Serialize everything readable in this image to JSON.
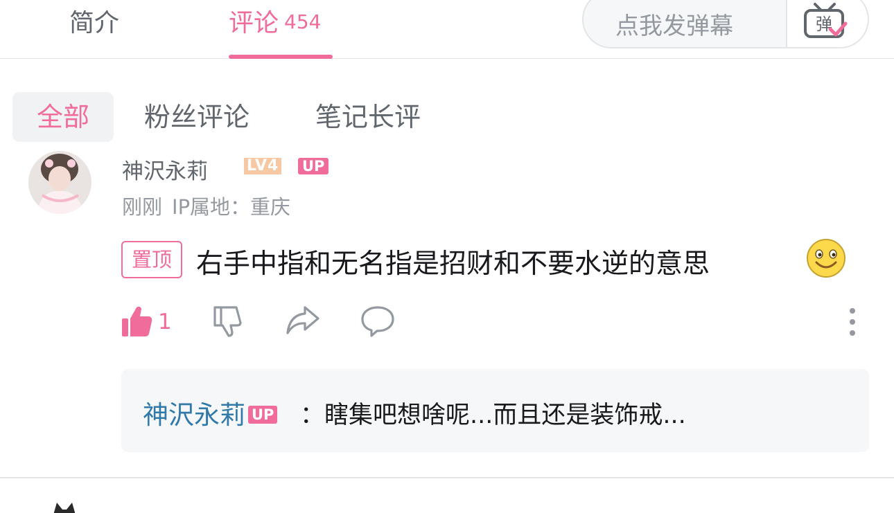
{
  "tabs": {
    "intro": "简介",
    "comments": "评论",
    "comment_count": "454"
  },
  "danmaku": {
    "placeholder": "点我发弹幕",
    "toggle_glyph": "弹"
  },
  "filters": {
    "all": "全部",
    "fans": "粉丝评论",
    "notes": "笔记长评"
  },
  "comment": {
    "username": "神沢永莉",
    "level": "LV4",
    "up_badge": "UP",
    "time": "刚刚",
    "ip": "IP属地：重庆",
    "pin_label": "置顶",
    "text": "右手中指和无名指是招财和不要水逆的意思",
    "emoji": "smile-emoji",
    "likes": "1",
    "accent_color": "#f06c9b"
  },
  "reply": {
    "username": "神沢永莉",
    "up_badge": "UP",
    "text": "：瞎集吧想啥呢...而且还是装饰戒..."
  },
  "icons": [
    "thumbs-up-icon",
    "thumbs-down-icon",
    "share-icon",
    "reply-icon",
    "more-icon",
    "danmaku-toggle-icon"
  ]
}
